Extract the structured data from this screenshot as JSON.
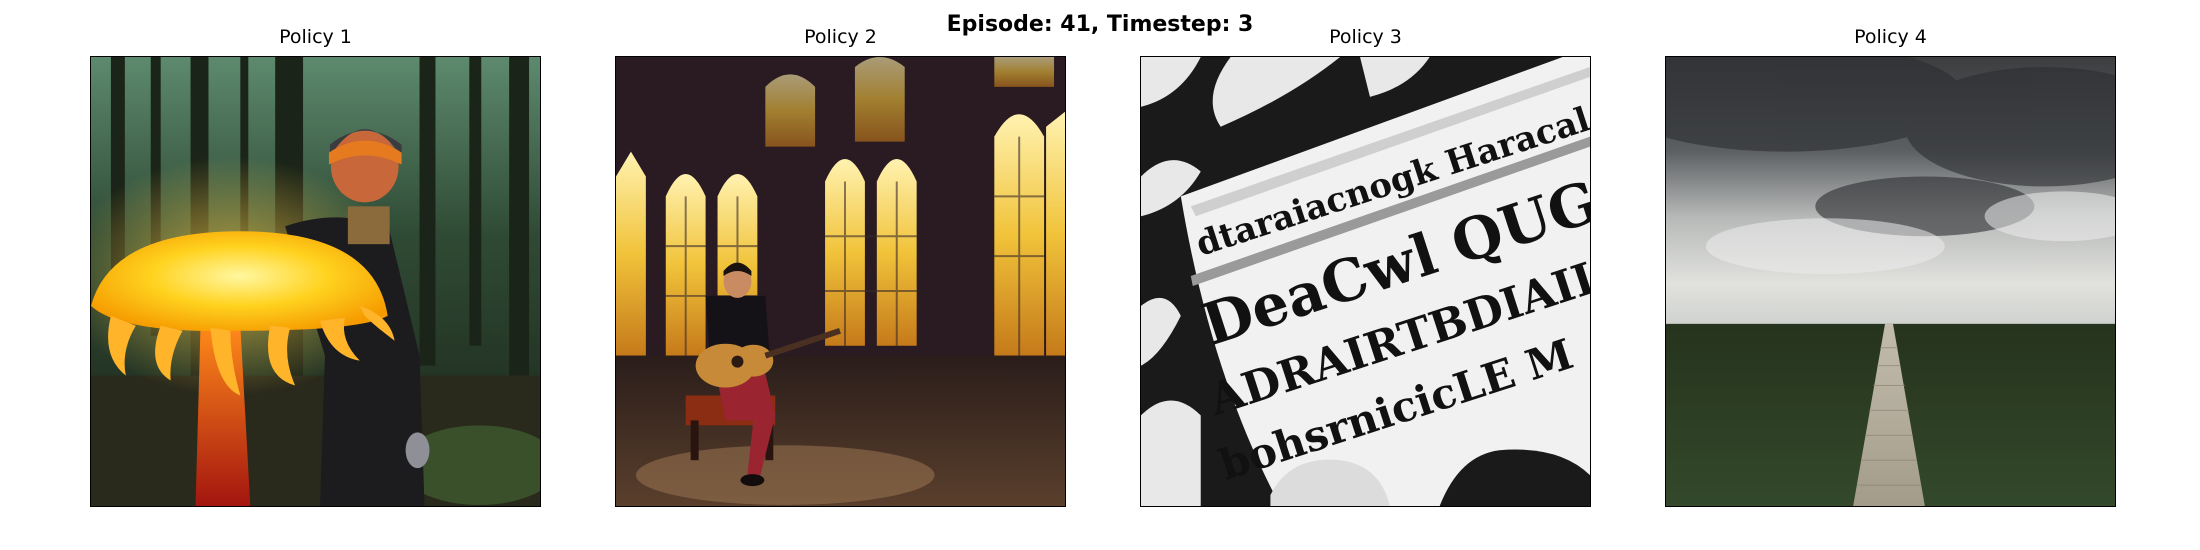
{
  "figure": {
    "title": "Episode: 41, Timestep: 3"
  },
  "panels": [
    {
      "title": "Policy 1",
      "image": "glowing-mushroom-forest-photo"
    },
    {
      "title": "Policy 2",
      "image": "guitarist-stained-glass-photo"
    },
    {
      "title": "Policy 3",
      "image": "newspaper-gothic-text-photo"
    },
    {
      "title": "Policy 4",
      "image": "storm-boardwalk-field-photo"
    }
  ],
  "newspaper_text": {
    "line1": "dtaraiacnogk Haracal",
    "line2": "DeaCwl QUG P",
    "line3": "ADRAIRTBDIAIL",
    "line4": "bohsrnicicLE M"
  }
}
